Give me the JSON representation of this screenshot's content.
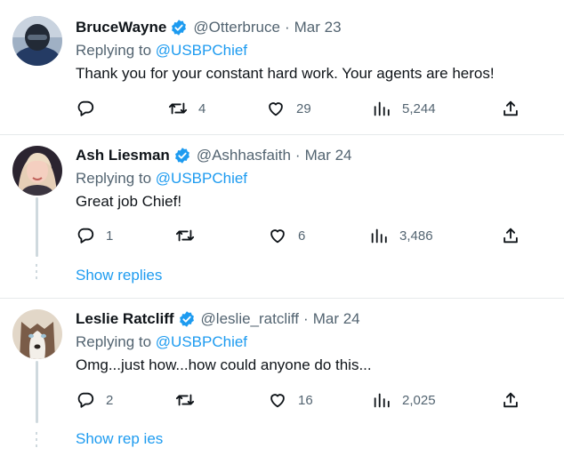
{
  "tweets": [
    {
      "name": "BruceWayne",
      "handle": "@Otterbruce",
      "date": "Mar 23",
      "replying_prefix": "Replying to ",
      "replying_to": "@USBPChief",
      "text": "Thank you for your constant hard work. Your agents are heros!",
      "replies": "",
      "retweets": "4",
      "likes": "29",
      "views": "5,244"
    },
    {
      "name": "Ash Liesman",
      "handle": "@Ashhasfaith",
      "date": "Mar 24",
      "replying_prefix": "Replying to ",
      "replying_to": "@USBPChief",
      "text": "Great job Chief!",
      "replies": "1",
      "retweets": "",
      "likes": "6",
      "views": "3,486",
      "show_replies": "Show replies"
    },
    {
      "name": "Leslie Ratcliff",
      "handle": "@leslie_ratcliff",
      "date": "Mar 24",
      "replying_prefix": "Replying to ",
      "replying_to": "@USBPChief",
      "text": "Omg...just how...how could anyone do this...",
      "replies": "2",
      "retweets": "",
      "likes": "16",
      "views": "2,025",
      "show_replies": "Show rep ies"
    }
  ],
  "separator": "·",
  "colors": {
    "accent": "#1d9bf0",
    "muted": "#536471",
    "text": "#0f1419",
    "border": "#e6e9eb"
  }
}
